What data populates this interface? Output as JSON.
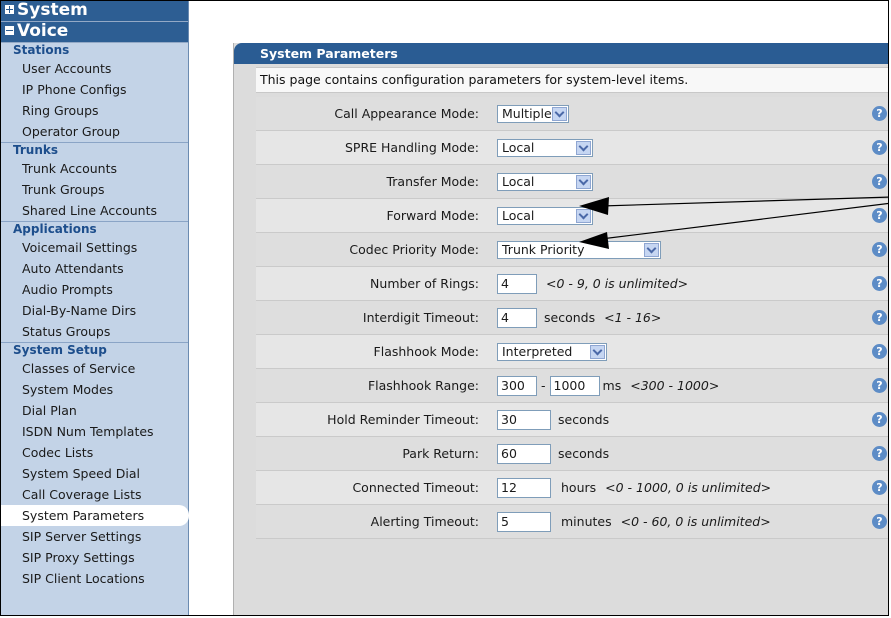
{
  "sidebar": {
    "sections": [
      {
        "label": "System",
        "expanded": false
      },
      {
        "label": "Voice",
        "expanded": true
      }
    ],
    "groups": [
      {
        "label": "Stations",
        "items": [
          "User Accounts",
          "IP Phone Configs",
          "Ring Groups",
          "Operator Group"
        ]
      },
      {
        "label": "Trunks",
        "items": [
          "Trunk Accounts",
          "Trunk Groups",
          "Shared Line Accounts"
        ]
      },
      {
        "label": "Applications",
        "items": [
          "Voicemail Settings",
          "Auto Attendants",
          "Audio Prompts",
          "Dial-By-Name Dirs",
          "Status Groups"
        ]
      },
      {
        "label": "System Setup",
        "items": [
          "Classes of Service",
          "System Modes",
          "Dial Plan",
          "ISDN Num Templates",
          "Codec Lists",
          "System Speed Dial",
          "Call Coverage Lists",
          "System Parameters",
          "SIP Server Settings",
          "SIP Proxy Settings",
          "SIP Client Locations"
        ]
      }
    ],
    "active_item": "System Parameters"
  },
  "panel": {
    "title": "System Parameters",
    "description": "This page contains configuration parameters for system-level items."
  },
  "params": {
    "call_appearance": {
      "label": "Call Appearance Mode:",
      "value": "Multiple"
    },
    "spre": {
      "label": "SPRE Handling Mode:",
      "value": "Local"
    },
    "transfer": {
      "label": "Transfer Mode:",
      "value": "Local"
    },
    "forward": {
      "label": "Forward Mode:",
      "value": "Local"
    },
    "codec": {
      "label": "Codec Priority Mode:",
      "value": "Trunk Priority"
    },
    "rings": {
      "label": "Number of Rings:",
      "value": "4",
      "hint": "<0 - 9, 0 is unlimited>"
    },
    "interdigit": {
      "label": "Interdigit Timeout:",
      "value": "4",
      "unit": "seconds",
      "hint": "<1 - 16>"
    },
    "flashhook_mode": {
      "label": "Flashhook Mode:",
      "value": "Interpreted"
    },
    "flashhook_range": {
      "label": "Flashhook Range:",
      "min": "300",
      "sep": "-",
      "max": "1000",
      "unit": "ms",
      "hint": "<300 - 1000>"
    },
    "hold_reminder": {
      "label": "Hold Reminder Timeout:",
      "value": "30",
      "unit": "seconds"
    },
    "park_return": {
      "label": "Park Return:",
      "value": "60",
      "unit": "seconds"
    },
    "connected": {
      "label": "Connected Timeout:",
      "value": "12",
      "unit": "hours",
      "hint": "<0 - 1000, 0 is unlimited>"
    },
    "alerting": {
      "label": "Alerting Timeout:",
      "value": "5",
      "unit": "minutes",
      "hint": "<0 - 60, 0 is unlimited>"
    }
  },
  "help_icon": "?",
  "colors": {
    "header_blue": "#2a5c93",
    "sidebar_bg": "#c3d3e7",
    "help_blue": "#5d8cc6"
  }
}
